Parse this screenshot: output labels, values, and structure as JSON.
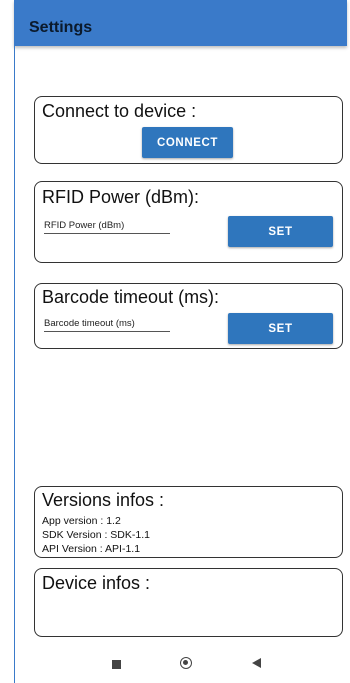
{
  "app_bar": {
    "title": "Settings",
    "color": "#3a7ac9"
  },
  "connect": {
    "title": "Connect to device :",
    "button": "CONNECT"
  },
  "rfid": {
    "title": "RFID Power (dBm):",
    "input_placeholder": "RFID Power (dBm)",
    "button": "SET"
  },
  "barcode": {
    "title": "Barcode timeout (ms):",
    "input_placeholder": "Barcode timeout (ms)",
    "button": "SET"
  },
  "versions": {
    "title": "Versions infos :",
    "app_version": "App version : 1.2",
    "sdk_version": "SDK Version : SDK-1.1",
    "api_version": "API Version : API-1.1"
  },
  "device": {
    "title": "Device infos :"
  },
  "nav": {
    "icons": [
      "recent-apps-icon",
      "home-icon",
      "back-icon"
    ]
  }
}
